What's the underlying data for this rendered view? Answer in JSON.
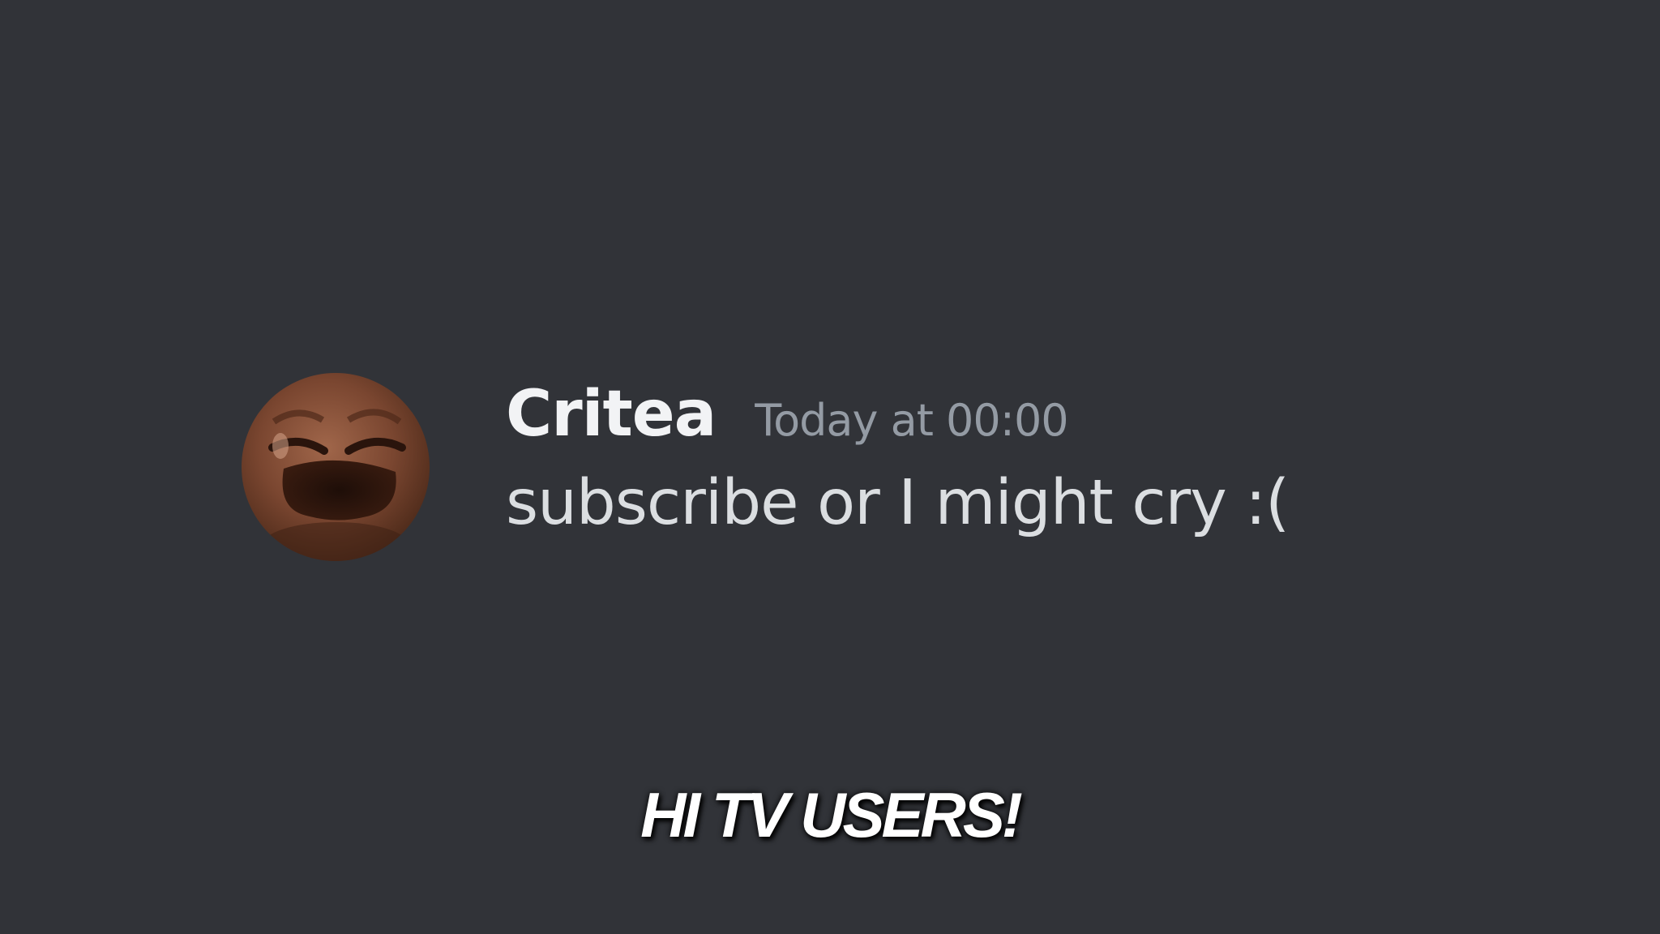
{
  "colors": {
    "background": "#313338",
    "username": "#f2f3f5",
    "timestamp": "#949ba4",
    "message_text": "#dbdee1",
    "caption": "#ffffff"
  },
  "message": {
    "avatar_icon": "crying-face-avatar",
    "username": "Critea",
    "timestamp": "Today at 00:00",
    "text": "subscribe or I might cry :("
  },
  "caption": {
    "text": "HI TV USERS!"
  }
}
